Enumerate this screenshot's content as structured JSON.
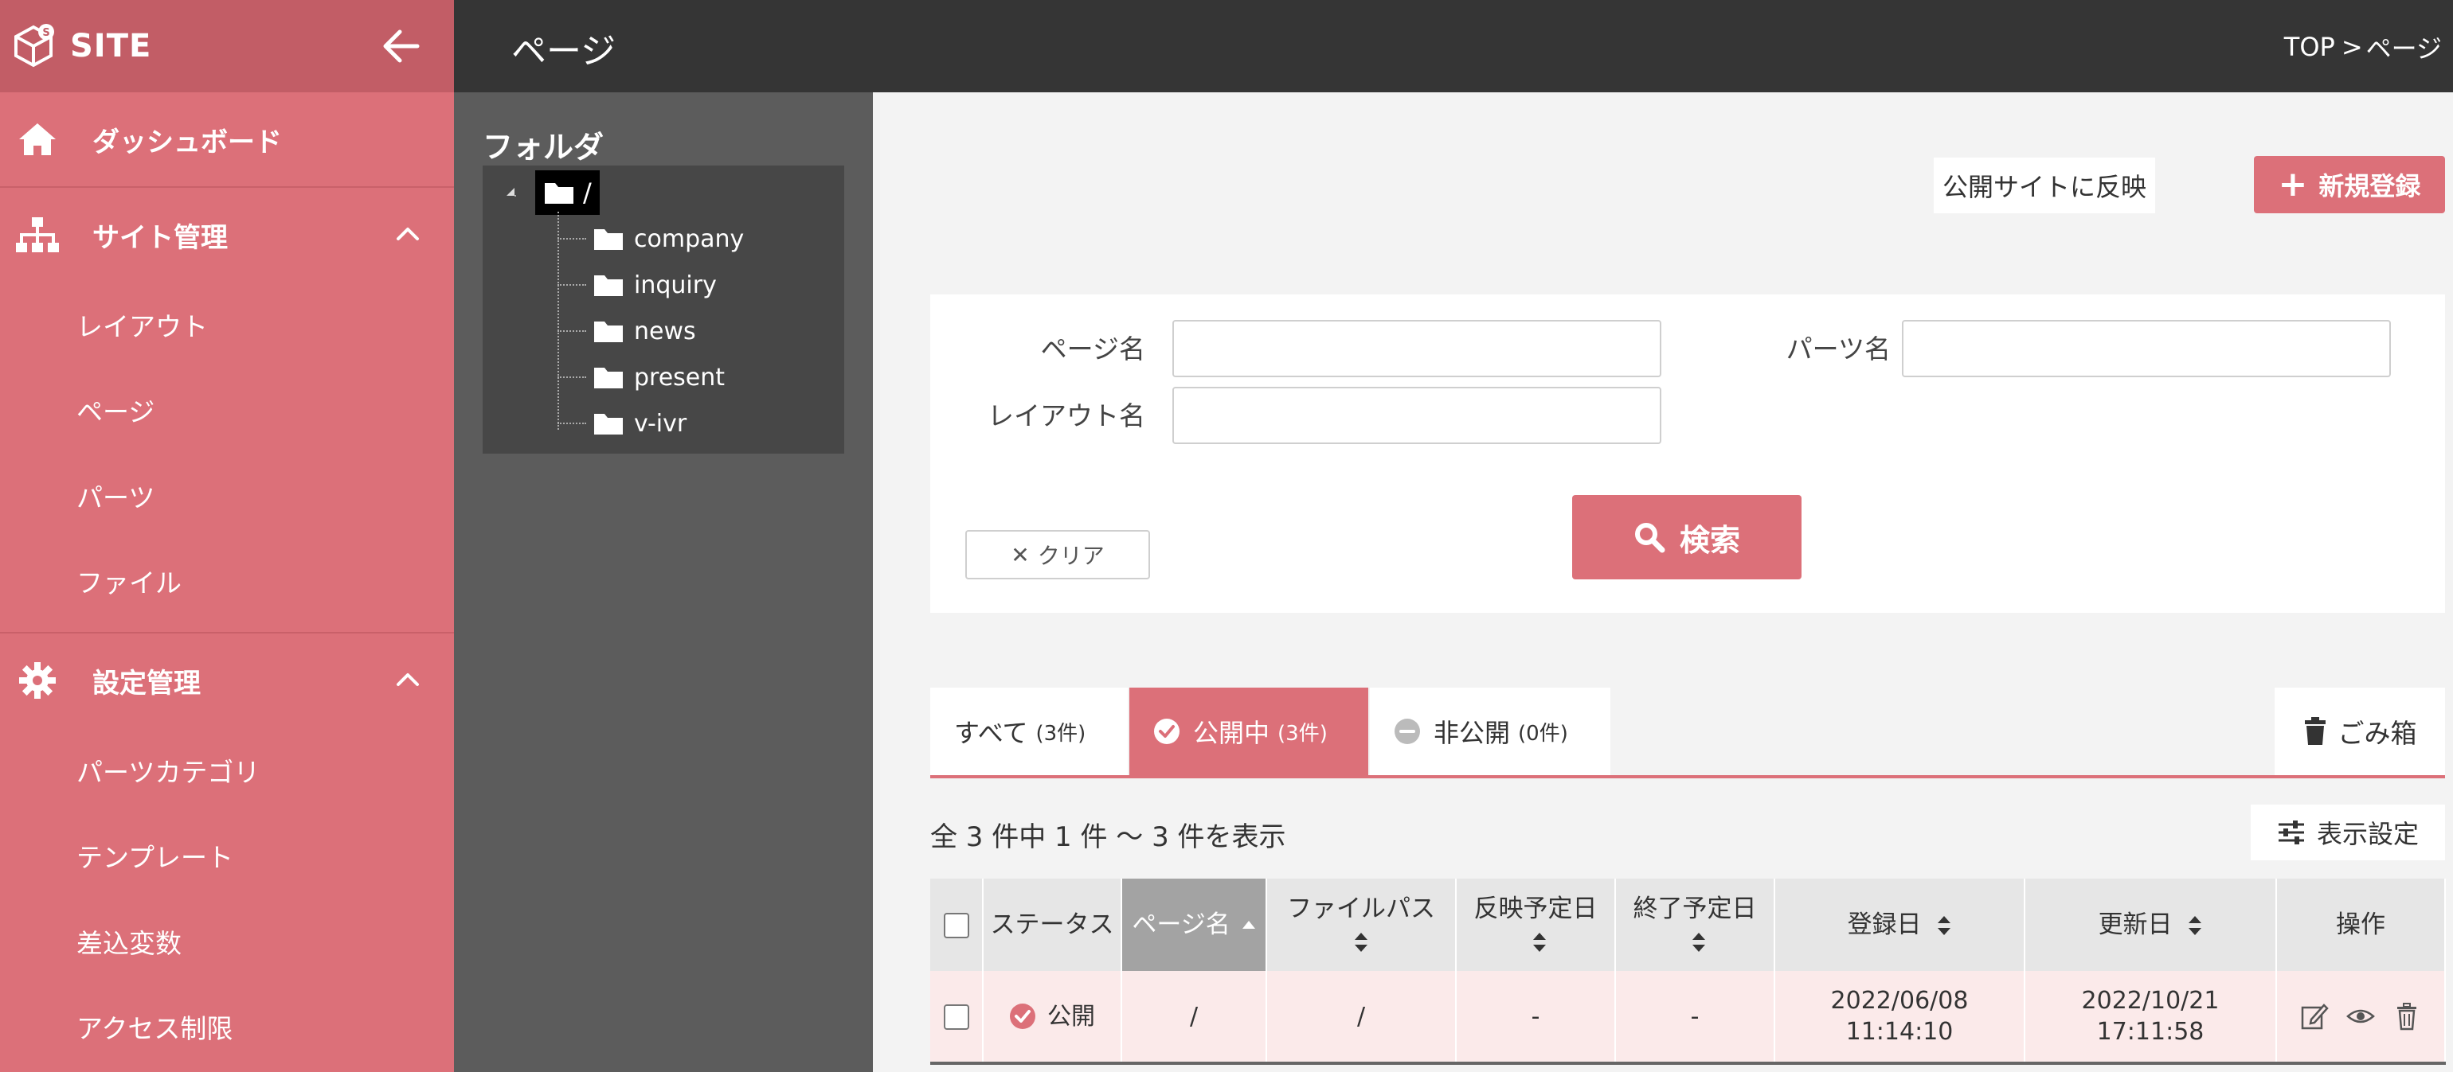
{
  "brand": {
    "title": "SITE",
    "accent": "#dc7079"
  },
  "sidebar": {
    "dashboard": "ダッシュボード",
    "site_manage": {
      "label": "サイト管理",
      "items": [
        "レイアウト",
        "ページ",
        "パーツ",
        "ファイル"
      ]
    },
    "settings_manage": {
      "label": "設定管理",
      "items": [
        "パーツカテゴリ",
        "テンプレート",
        "差込変数",
        "アクセス制限"
      ]
    }
  },
  "header": {
    "title": "ページ",
    "breadcrumb": {
      "top": "TOP",
      "sep": ">",
      "current": "ページ"
    }
  },
  "folder": {
    "title": "フォルダ",
    "root": "/",
    "children": [
      "company",
      "inquiry",
      "news",
      "present",
      "v-ivr"
    ]
  },
  "actions": {
    "publish": "公開サイトに反映",
    "new": "新規登録"
  },
  "search": {
    "page_name_label": "ページ名",
    "parts_name_label": "パーツ名",
    "layout_name_label": "レイアウト名",
    "page_name_value": "",
    "parts_name_value": "",
    "layout_name_value": "",
    "clear": "クリア",
    "submit": "検索"
  },
  "tabs": {
    "all": {
      "label": "すべて",
      "count": "(3件)"
    },
    "published": {
      "label": "公開中",
      "count": "(3件)"
    },
    "unpublished": {
      "label": "非公開",
      "count": "(0件)"
    },
    "trash": "ごみ箱"
  },
  "list": {
    "count_text": "全 3 件中 1 件 〜 3 件を表示",
    "display_settings": "表示設定",
    "columns": {
      "status": "ステータス",
      "page_name": "ページ名",
      "file_path": "ファイルパス",
      "publish_date": "反映予定日",
      "end_date": "終了予定日",
      "created": "登録日",
      "updated": "更新日",
      "ops": "操作"
    },
    "rows": [
      {
        "status": "公開",
        "page_name": "/",
        "file_path": "/",
        "publish_date": "-",
        "end_date": "-",
        "created_date": "2022/06/08",
        "created_time": "11:14:10",
        "updated_date": "2022/10/21",
        "updated_time": "17:11:58"
      }
    ]
  }
}
